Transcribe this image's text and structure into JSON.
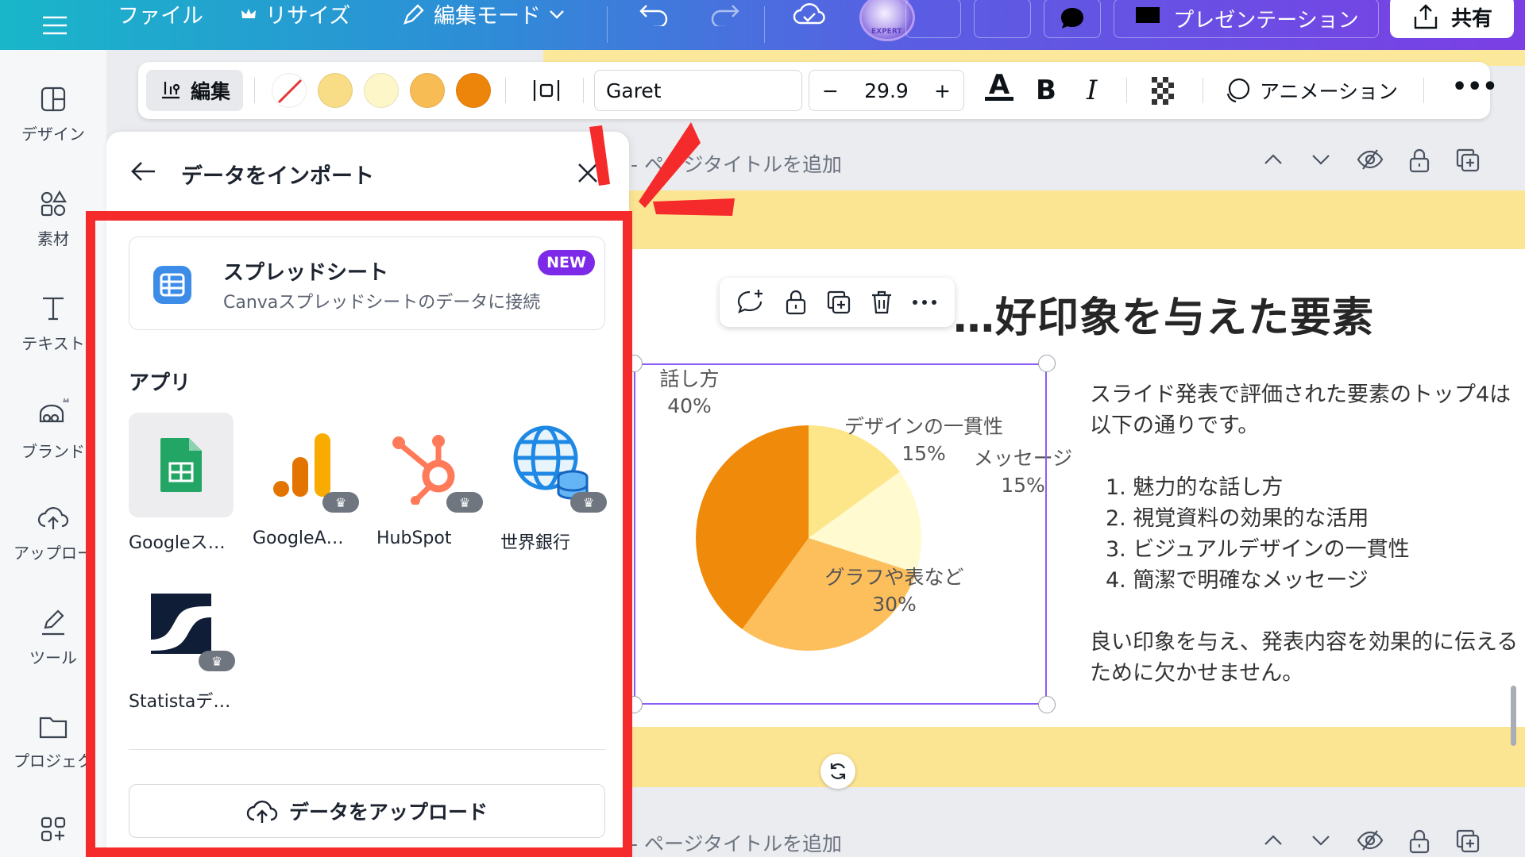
{
  "topbar": {
    "menu_icon": "hamburger-icon",
    "file_label": "ファイル",
    "resize_label": "リサイズ",
    "edit_mode_label": "編集モード",
    "present_label": "プレゼンテーション",
    "share_label": "共有",
    "avatar_text": "EXPERT"
  },
  "rail": {
    "items": [
      {
        "label": "デザイン",
        "icon": "layout-icon"
      },
      {
        "label": "素材",
        "icon": "elements-icon"
      },
      {
        "label": "テキスト",
        "icon": "text-icon"
      },
      {
        "label": "ブランド",
        "icon": "brand-icon"
      },
      {
        "label": "アップロー",
        "icon": "upload-cloud-icon"
      },
      {
        "label": "ツール",
        "icon": "draw-icon"
      },
      {
        "label": "プロジェク",
        "icon": "folder-icon"
      }
    ]
  },
  "toolbar": {
    "edit_label": "編集",
    "swatches": [
      "#f9dd86",
      "#fdf6c8",
      "#f8bc55",
      "#ee850b"
    ],
    "font_name": "Garet",
    "font_size": "29.9",
    "minus": "−",
    "plus": "+",
    "text_color_glyph": "A",
    "bold_glyph": "B",
    "italic_glyph": "I",
    "animation_label": "アニメーション",
    "more_glyph": "•••"
  },
  "page": {
    "title_placeholder": "- ページタイトルを追加",
    "next_title_placeholder": "- ページタイトルを追加"
  },
  "slide": {
    "heading": "…好印象を与えた要素",
    "paragraph1": "スライド発表で評価された要素のトップ4は以下の通りです。",
    "list": [
      "1. 魅力的な話し方",
      "2. 視覚資料の効果的な活用",
      "3. ビジュアルデザインの一貫性",
      "4. 簡潔で明確なメッセージ"
    ],
    "paragraph2": "良い印象を与え、発表内容を効果的に伝えるために欠かせません。"
  },
  "chart_data": {
    "type": "pie",
    "slices": [
      {
        "label": "デザインの一貫性",
        "value": 15,
        "display": "15%",
        "color": "#fde68a"
      },
      {
        "label": "メッセージ",
        "value": 15,
        "display": "15%",
        "color": "#fffad0"
      },
      {
        "label": "グラフや表など",
        "value": 30,
        "display": "30%",
        "color": "#fdbf5c"
      },
      {
        "label": "話し方",
        "value": 40,
        "display": "40%",
        "color": "#f08a0a"
      }
    ]
  },
  "panel": {
    "back_icon": "arrow-left-icon",
    "title": "データをインポート",
    "close_icon": "close-icon",
    "spreadsheet": {
      "title": "スプレッドシート",
      "subtitle": "Canvaスプレッドシートのデータに接続",
      "badge": "NEW"
    },
    "apps_heading": "アプリ",
    "apps": [
      {
        "label": "Googleス…",
        "icon": "google-sheets-icon",
        "premium": false
      },
      {
        "label": "GoogleA…",
        "icon": "google-analytics-icon",
        "premium": true
      },
      {
        "label": "HubSpot",
        "icon": "hubspot-icon",
        "premium": true
      },
      {
        "label": "世界銀行",
        "icon": "world-bank-icon",
        "premium": true
      },
      {
        "label": "Statistaデ…",
        "icon": "statista-icon",
        "premium": true
      }
    ],
    "upload_label": "データをアップロード"
  },
  "colors": {
    "accent_purple": "#7d2ae8",
    "highlight_red": "#f52a2a",
    "slide_band": "#fbe593"
  }
}
